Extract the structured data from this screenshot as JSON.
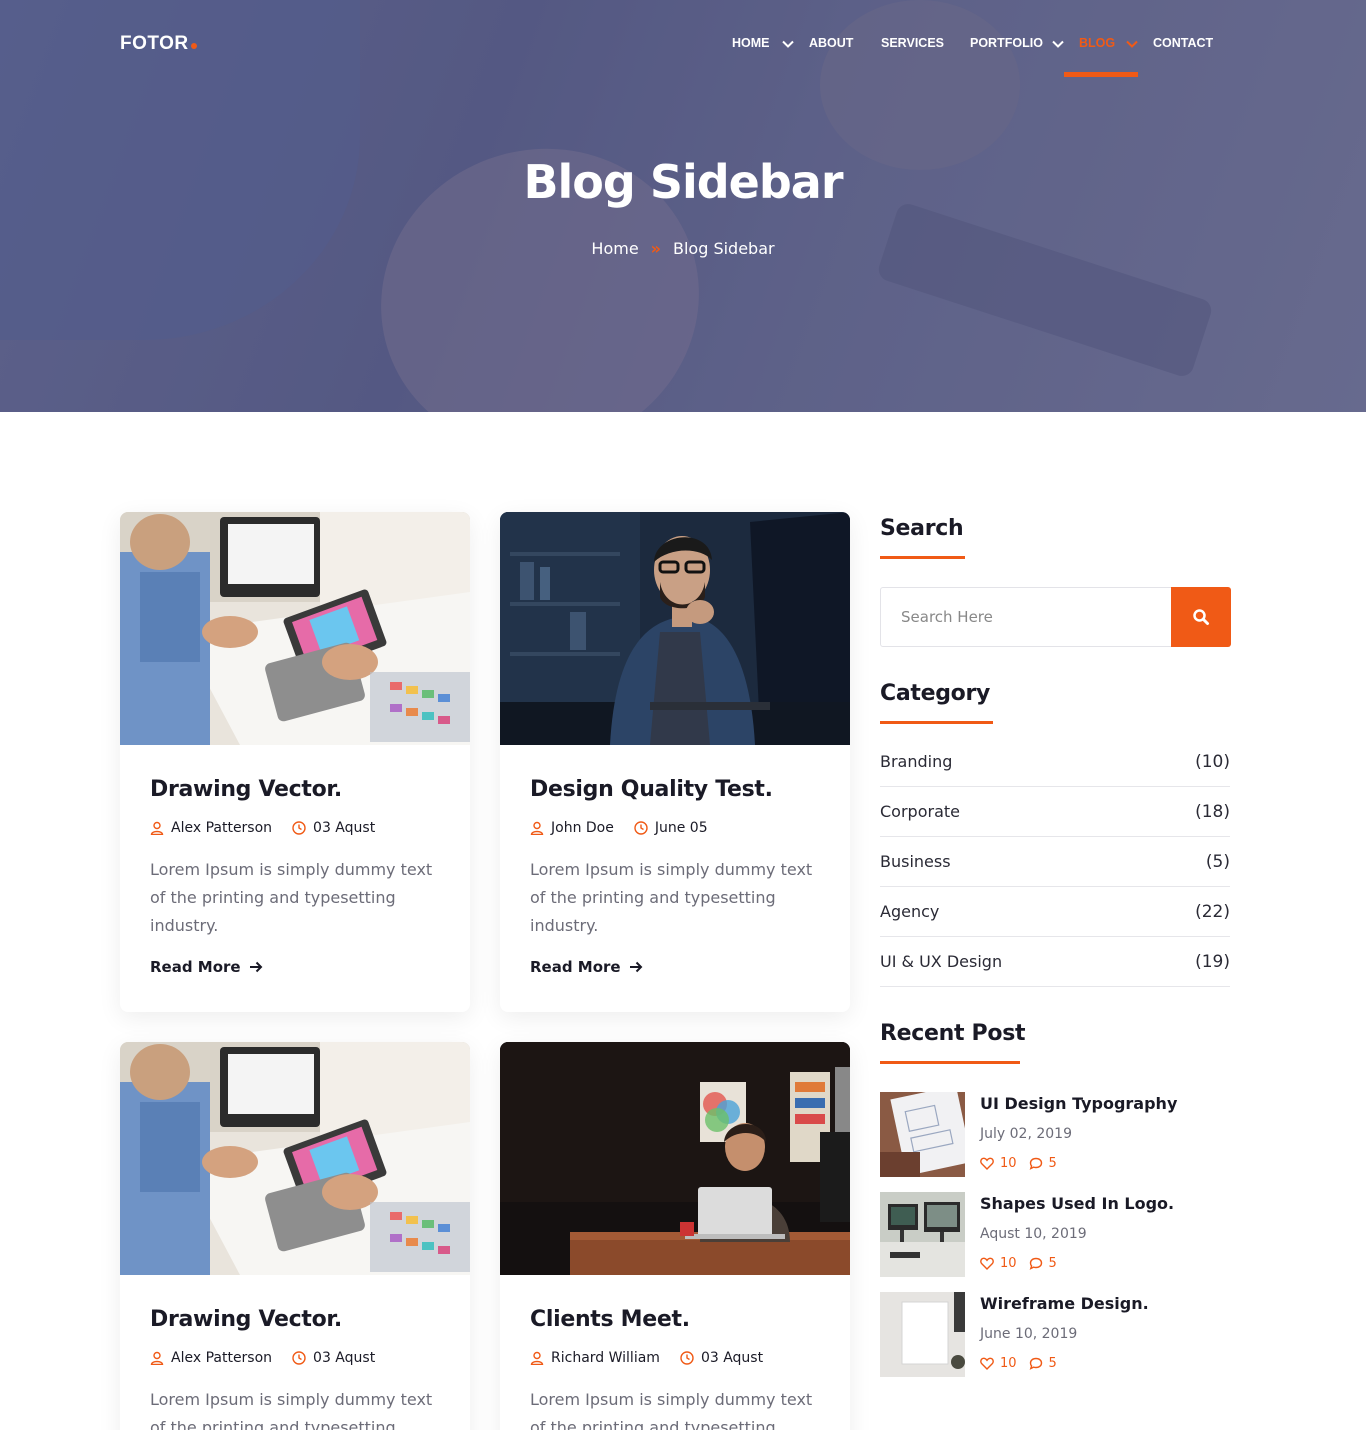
{
  "brand": {
    "name": "FOTOR",
    "accent": "#f05a16"
  },
  "nav": {
    "items": [
      {
        "label": "HOME",
        "active": false
      },
      {
        "label": "ABOUT",
        "active": false
      },
      {
        "label": "SERVICES",
        "active": false
      },
      {
        "label": "PORTFOLIO",
        "active": false
      },
      {
        "label": "BLOG",
        "active": true
      },
      {
        "label": "CONTACT",
        "active": false
      }
    ]
  },
  "hero": {
    "title": "Blog Sidebar",
    "breadcrumb": {
      "home": "Home",
      "current": "Blog Sidebar"
    }
  },
  "posts": [
    {
      "title": "Drawing Vector.",
      "author": "Alex Patterson",
      "date": "03 Aqust",
      "excerpt": "Lorem Ipsum is simply dummy text of the printing and typesetting industry.",
      "read_more": "Read More",
      "image": "designer-tablet"
    },
    {
      "title": "Design Quality Test.",
      "author": "John Doe",
      "date": "June 05",
      "excerpt": "Lorem Ipsum is simply dummy text of the printing and typesetting industry.",
      "read_more": "Read More",
      "image": "man-thinking-desk"
    },
    {
      "title": "Drawing Vector.",
      "author": "Alex Patterson",
      "date": "03 Aqust",
      "excerpt": "Lorem Ipsum is simply dummy text of the printing and typesetting",
      "image": "designer-tablet"
    },
    {
      "title": "Clients Meet.",
      "author": "Richard William",
      "date": "03 Aqust",
      "excerpt": "Lorem Ipsum is simply dummy text of the printing and typesetting",
      "image": "man-laptop-dark"
    }
  ],
  "sidebar": {
    "search": {
      "title": "Search",
      "placeholder": "Search Here"
    },
    "category": {
      "title": "Category",
      "items": [
        {
          "name": "Branding",
          "count": "(10)"
        },
        {
          "name": "Corporate",
          "count": "(18)"
        },
        {
          "name": "Business",
          "count": "(5)"
        },
        {
          "name": "Agency",
          "count": "(22)"
        },
        {
          "name": "UI & UX Design",
          "count": "(19)"
        }
      ]
    },
    "recent": {
      "title": "Recent Post",
      "items": [
        {
          "title": "UI Design Typography",
          "date": "July 02, 2019",
          "likes": "10",
          "comments": "5"
        },
        {
          "title": "Shapes Used In Logo.",
          "date": "Aqust 10, 2019",
          "likes": "10",
          "comments": "5"
        },
        {
          "title": "Wireframe Design.",
          "date": "June 10, 2019",
          "likes": "10",
          "comments": "5"
        }
      ]
    }
  }
}
